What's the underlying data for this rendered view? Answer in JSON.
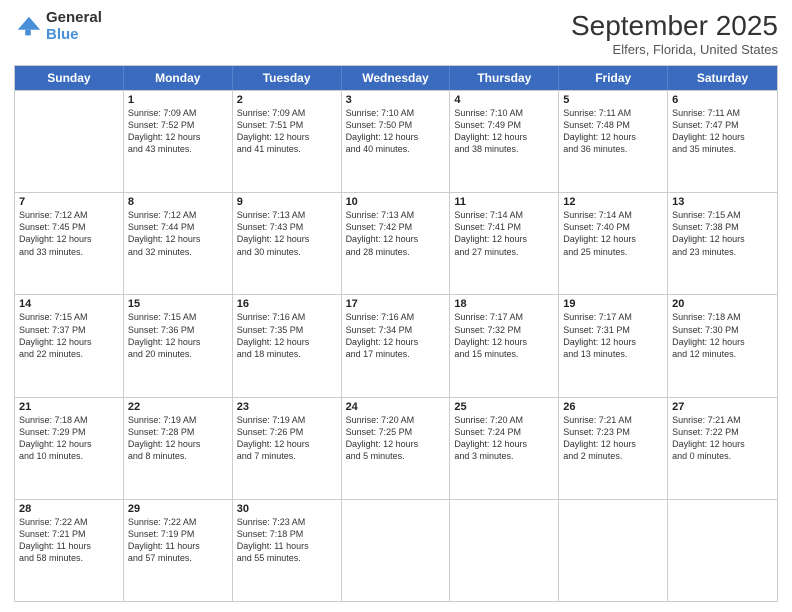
{
  "header": {
    "logo_line1": "General",
    "logo_line2": "Blue",
    "month_title": "September 2025",
    "location": "Elfers, Florida, United States"
  },
  "weekdays": [
    "Sunday",
    "Monday",
    "Tuesday",
    "Wednesday",
    "Thursday",
    "Friday",
    "Saturday"
  ],
  "rows": [
    [
      {
        "date": "",
        "info": ""
      },
      {
        "date": "1",
        "info": "Sunrise: 7:09 AM\nSunset: 7:52 PM\nDaylight: 12 hours\nand 43 minutes."
      },
      {
        "date": "2",
        "info": "Sunrise: 7:09 AM\nSunset: 7:51 PM\nDaylight: 12 hours\nand 41 minutes."
      },
      {
        "date": "3",
        "info": "Sunrise: 7:10 AM\nSunset: 7:50 PM\nDaylight: 12 hours\nand 40 minutes."
      },
      {
        "date": "4",
        "info": "Sunrise: 7:10 AM\nSunset: 7:49 PM\nDaylight: 12 hours\nand 38 minutes."
      },
      {
        "date": "5",
        "info": "Sunrise: 7:11 AM\nSunset: 7:48 PM\nDaylight: 12 hours\nand 36 minutes."
      },
      {
        "date": "6",
        "info": "Sunrise: 7:11 AM\nSunset: 7:47 PM\nDaylight: 12 hours\nand 35 minutes."
      }
    ],
    [
      {
        "date": "7",
        "info": "Sunrise: 7:12 AM\nSunset: 7:45 PM\nDaylight: 12 hours\nand 33 minutes."
      },
      {
        "date": "8",
        "info": "Sunrise: 7:12 AM\nSunset: 7:44 PM\nDaylight: 12 hours\nand 32 minutes."
      },
      {
        "date": "9",
        "info": "Sunrise: 7:13 AM\nSunset: 7:43 PM\nDaylight: 12 hours\nand 30 minutes."
      },
      {
        "date": "10",
        "info": "Sunrise: 7:13 AM\nSunset: 7:42 PM\nDaylight: 12 hours\nand 28 minutes."
      },
      {
        "date": "11",
        "info": "Sunrise: 7:14 AM\nSunset: 7:41 PM\nDaylight: 12 hours\nand 27 minutes."
      },
      {
        "date": "12",
        "info": "Sunrise: 7:14 AM\nSunset: 7:40 PM\nDaylight: 12 hours\nand 25 minutes."
      },
      {
        "date": "13",
        "info": "Sunrise: 7:15 AM\nSunset: 7:38 PM\nDaylight: 12 hours\nand 23 minutes."
      }
    ],
    [
      {
        "date": "14",
        "info": "Sunrise: 7:15 AM\nSunset: 7:37 PM\nDaylight: 12 hours\nand 22 minutes."
      },
      {
        "date": "15",
        "info": "Sunrise: 7:15 AM\nSunset: 7:36 PM\nDaylight: 12 hours\nand 20 minutes."
      },
      {
        "date": "16",
        "info": "Sunrise: 7:16 AM\nSunset: 7:35 PM\nDaylight: 12 hours\nand 18 minutes."
      },
      {
        "date": "17",
        "info": "Sunrise: 7:16 AM\nSunset: 7:34 PM\nDaylight: 12 hours\nand 17 minutes."
      },
      {
        "date": "18",
        "info": "Sunrise: 7:17 AM\nSunset: 7:32 PM\nDaylight: 12 hours\nand 15 minutes."
      },
      {
        "date": "19",
        "info": "Sunrise: 7:17 AM\nSunset: 7:31 PM\nDaylight: 12 hours\nand 13 minutes."
      },
      {
        "date": "20",
        "info": "Sunrise: 7:18 AM\nSunset: 7:30 PM\nDaylight: 12 hours\nand 12 minutes."
      }
    ],
    [
      {
        "date": "21",
        "info": "Sunrise: 7:18 AM\nSunset: 7:29 PM\nDaylight: 12 hours\nand 10 minutes."
      },
      {
        "date": "22",
        "info": "Sunrise: 7:19 AM\nSunset: 7:28 PM\nDaylight: 12 hours\nand 8 minutes."
      },
      {
        "date": "23",
        "info": "Sunrise: 7:19 AM\nSunset: 7:26 PM\nDaylight: 12 hours\nand 7 minutes."
      },
      {
        "date": "24",
        "info": "Sunrise: 7:20 AM\nSunset: 7:25 PM\nDaylight: 12 hours\nand 5 minutes."
      },
      {
        "date": "25",
        "info": "Sunrise: 7:20 AM\nSunset: 7:24 PM\nDaylight: 12 hours\nand 3 minutes."
      },
      {
        "date": "26",
        "info": "Sunrise: 7:21 AM\nSunset: 7:23 PM\nDaylight: 12 hours\nand 2 minutes."
      },
      {
        "date": "27",
        "info": "Sunrise: 7:21 AM\nSunset: 7:22 PM\nDaylight: 12 hours\nand 0 minutes."
      }
    ],
    [
      {
        "date": "28",
        "info": "Sunrise: 7:22 AM\nSunset: 7:21 PM\nDaylight: 11 hours\nand 58 minutes."
      },
      {
        "date": "29",
        "info": "Sunrise: 7:22 AM\nSunset: 7:19 PM\nDaylight: 11 hours\nand 57 minutes."
      },
      {
        "date": "30",
        "info": "Sunrise: 7:23 AM\nSunset: 7:18 PM\nDaylight: 11 hours\nand 55 minutes."
      },
      {
        "date": "",
        "info": ""
      },
      {
        "date": "",
        "info": ""
      },
      {
        "date": "",
        "info": ""
      },
      {
        "date": "",
        "info": ""
      }
    ]
  ]
}
